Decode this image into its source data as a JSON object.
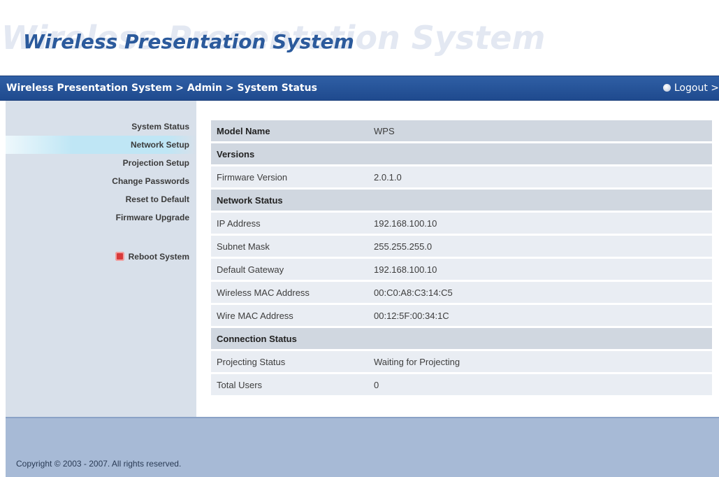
{
  "header": {
    "title": "Wireless Presentation System",
    "watermark": "Wireless Presentation System"
  },
  "navbar": {
    "breadcrumb": "Wireless Presentation System > Admin > System Status",
    "logout_label": "Logout >",
    "logout_icon": "logout-icon"
  },
  "sidebar": {
    "items": [
      {
        "label": "System Status",
        "active": false
      },
      {
        "label": "Network Setup",
        "active": true
      },
      {
        "label": "Projection Setup",
        "active": false
      },
      {
        "label": "Change Passwords",
        "active": false
      },
      {
        "label": "Reset to Default",
        "active": false
      },
      {
        "label": "Firmware Upgrade",
        "active": false
      }
    ],
    "reboot_label": "Reboot System",
    "reboot_icon": "reboot-icon"
  },
  "status": {
    "model_name_label": "Model Name",
    "model_name_value": "WPS",
    "versions_header": "Versions",
    "firmware_label": "Firmware Version",
    "firmware_value": "2.0.1.0",
    "network_header": "Network Status",
    "ip_label": "IP Address",
    "ip_value": "192.168.100.10",
    "subnet_label": "Subnet Mask",
    "subnet_value": "255.255.255.0",
    "gateway_label": "Default Gateway",
    "gateway_value": "192.168.100.10",
    "wireless_mac_label": "Wireless MAC Address",
    "wireless_mac_value": "00:C0:A8:C3:14:C5",
    "wire_mac_label": "Wire MAC Address",
    "wire_mac_value": "00:12:5F:00:34:1C",
    "connection_header": "Connection Status",
    "projecting_label": "Projecting Status",
    "projecting_value": "Waiting for Projecting",
    "users_label": "Total Users",
    "users_value": "0"
  },
  "footer": {
    "copyright": "Copyright © 2003 - 2007. All rights reserved."
  },
  "colors": {
    "accent": "#2b5a9c",
    "navbar": "#244f94",
    "sidebar": "#d8e0ea",
    "footer": "#a7bad6"
  }
}
